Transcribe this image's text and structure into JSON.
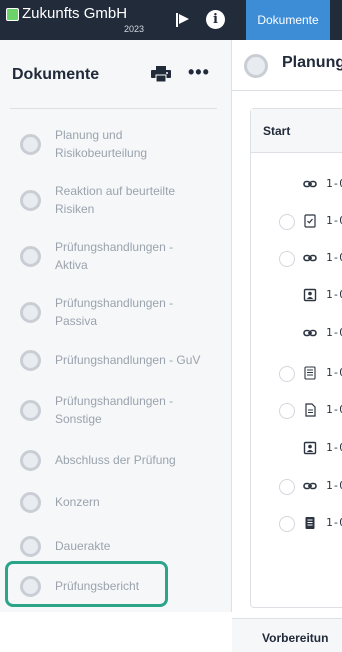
{
  "topbar": {
    "company": "Zukunfts GmbH",
    "year": "2023",
    "active_tab": "Dokumente"
  },
  "sidebar": {
    "title": "Dokumente",
    "items": [
      {
        "label": "Planung und Risikobeurteilung"
      },
      {
        "label": "Reaktion auf beurteilte Risiken"
      },
      {
        "label": "Prüfungshandlungen - Aktiva"
      },
      {
        "label": "Prüfungshandlungen - Passiva"
      },
      {
        "label": "Prüfungshandlungen - GuV"
      },
      {
        "label": "Prüfungshandlungen - Sonstige"
      },
      {
        "label": "Abschluss der Prüfung"
      },
      {
        "label": "Konzern"
      },
      {
        "label": "Dauerakte"
      },
      {
        "label": "Prüfungsbericht"
      }
    ]
  },
  "main": {
    "title": "Planung",
    "section_label": "Start",
    "next_section_label": "Vorbereitun",
    "rows": [
      {
        "icon": "link-icon",
        "checkbox": false,
        "code": "1-0"
      },
      {
        "icon": "checklist-icon",
        "checkbox": true,
        "code": "1-0"
      },
      {
        "icon": "link-icon",
        "checkbox": true,
        "code": "1-0"
      },
      {
        "icon": "contact-card-icon",
        "checkbox": false,
        "code": "1-0"
      },
      {
        "icon": "link-icon",
        "checkbox": false,
        "code": "1-0"
      },
      {
        "icon": "list-doc-icon",
        "checkbox": true,
        "code": "1-0"
      },
      {
        "icon": "document-icon",
        "checkbox": true,
        "code": "1-0"
      },
      {
        "icon": "contact-card-icon",
        "checkbox": false,
        "code": "1-0"
      },
      {
        "icon": "link-icon",
        "checkbox": true,
        "code": "1-0"
      },
      {
        "icon": "form-doc-icon",
        "checkbox": true,
        "code": "1-0"
      }
    ]
  },
  "colors": {
    "topbar": "#222b3a",
    "accent_tab": "#3d8cd6",
    "brand": "#6bd36a",
    "highlight": "#2aa58a"
  }
}
